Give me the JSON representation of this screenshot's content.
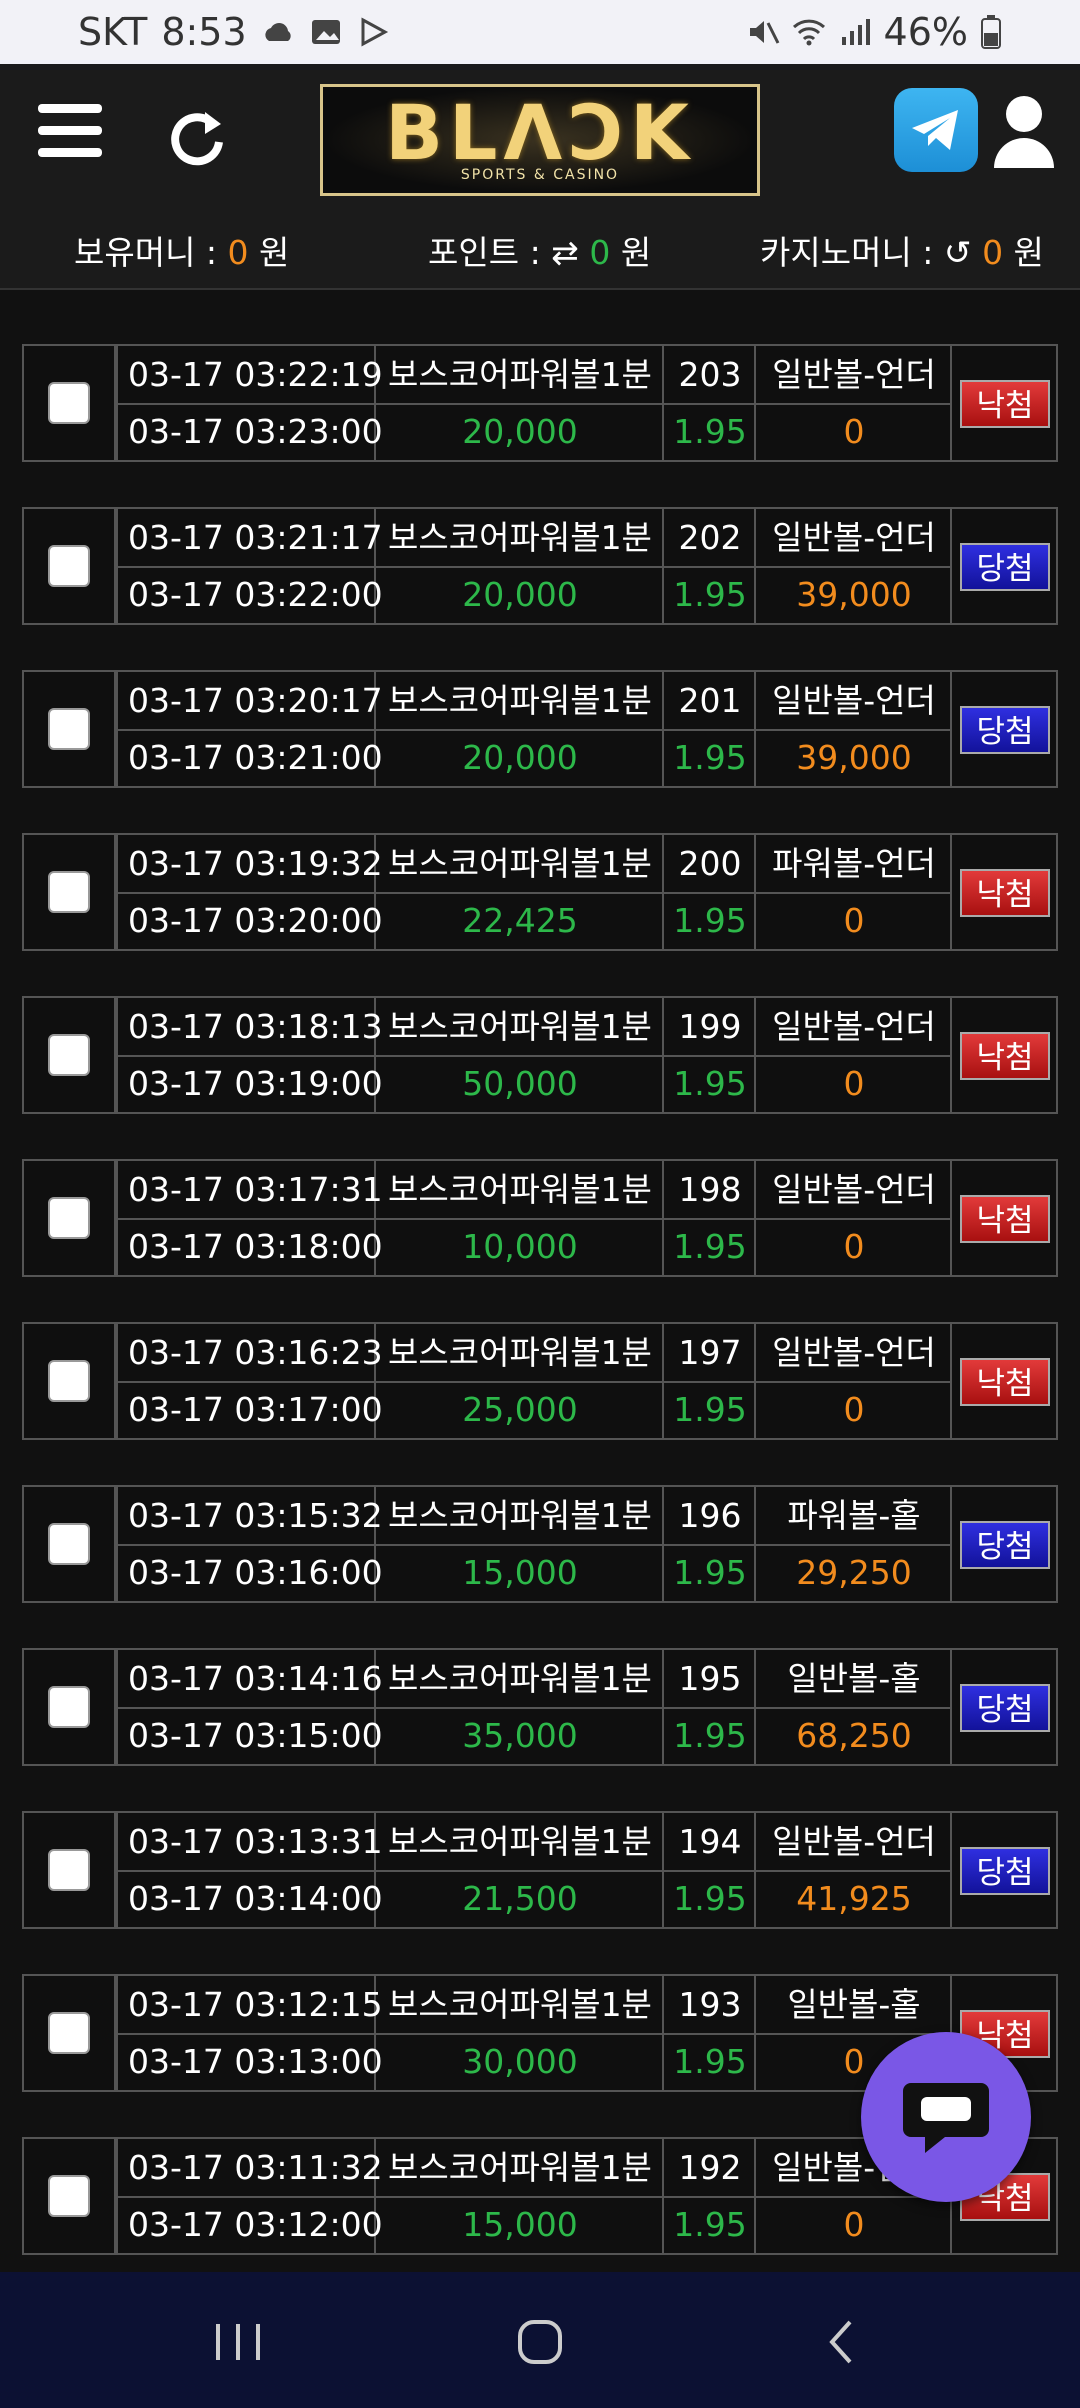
{
  "statusbar": {
    "carrier": "SKT",
    "time": "8:53",
    "battery": "46%"
  },
  "header": {
    "logo_text": "BLΛƆK",
    "logo_sub": "SPORTS & CASINO"
  },
  "balance": {
    "money_label": "보유머니 : ",
    "money_value": "0",
    "money_unit": " 원",
    "point_label": "포인트 : ",
    "point_value": "0",
    "point_unit": " 원",
    "casino_label": "카지노머니 : ",
    "casino_value": "0",
    "casino_unit": " 원"
  },
  "colors": {
    "win_badge": "#2020c0",
    "lose_badge": "#c02020",
    "amount": "#2db84a",
    "payout": "#f28c1e",
    "chat": "#7a57e6"
  },
  "bets": [
    {
      "bet_time": "03-17 03:22:19",
      "draw_time": "03-17 03:23:00",
      "game": "보스코어파워볼1분",
      "round": "203",
      "pick": "일반볼-언더",
      "amount": "20,000",
      "odds": "1.95",
      "payout": "0",
      "result": "낙첨"
    },
    {
      "bet_time": "03-17 03:21:17",
      "draw_time": "03-17 03:22:00",
      "game": "보스코어파워볼1분",
      "round": "202",
      "pick": "일반볼-언더",
      "amount": "20,000",
      "odds": "1.95",
      "payout": "39,000",
      "result": "당첨"
    },
    {
      "bet_time": "03-17 03:20:17",
      "draw_time": "03-17 03:21:00",
      "game": "보스코어파워볼1분",
      "round": "201",
      "pick": "일반볼-언더",
      "amount": "20,000",
      "odds": "1.95",
      "payout": "39,000",
      "result": "당첨"
    },
    {
      "bet_time": "03-17 03:19:32",
      "draw_time": "03-17 03:20:00",
      "game": "보스코어파워볼1분",
      "round": "200",
      "pick": "파워볼-언더",
      "amount": "22,425",
      "odds": "1.95",
      "payout": "0",
      "result": "낙첨"
    },
    {
      "bet_time": "03-17 03:18:13",
      "draw_time": "03-17 03:19:00",
      "game": "보스코어파워볼1분",
      "round": "199",
      "pick": "일반볼-언더",
      "amount": "50,000",
      "odds": "1.95",
      "payout": "0",
      "result": "낙첨"
    },
    {
      "bet_time": "03-17 03:17:31",
      "draw_time": "03-17 03:18:00",
      "game": "보스코어파워볼1분",
      "round": "198",
      "pick": "일반볼-언더",
      "amount": "10,000",
      "odds": "1.95",
      "payout": "0",
      "result": "낙첨"
    },
    {
      "bet_time": "03-17 03:16:23",
      "draw_time": "03-17 03:17:00",
      "game": "보스코어파워볼1분",
      "round": "197",
      "pick": "일반볼-언더",
      "amount": "25,000",
      "odds": "1.95",
      "payout": "0",
      "result": "낙첨"
    },
    {
      "bet_time": "03-17 03:15:32",
      "draw_time": "03-17 03:16:00",
      "game": "보스코어파워볼1분",
      "round": "196",
      "pick": "파워볼-홀",
      "amount": "15,000",
      "odds": "1.95",
      "payout": "29,250",
      "result": "당첨"
    },
    {
      "bet_time": "03-17 03:14:16",
      "draw_time": "03-17 03:15:00",
      "game": "보스코어파워볼1분",
      "round": "195",
      "pick": "일반볼-홀",
      "amount": "35,000",
      "odds": "1.95",
      "payout": "68,250",
      "result": "당첨"
    },
    {
      "bet_time": "03-17 03:13:31",
      "draw_time": "03-17 03:14:00",
      "game": "보스코어파워볼1분",
      "round": "194",
      "pick": "일반볼-언더",
      "amount": "21,500",
      "odds": "1.95",
      "payout": "41,925",
      "result": "당첨"
    },
    {
      "bet_time": "03-17 03:12:15",
      "draw_time": "03-17 03:13:00",
      "game": "보스코어파워볼1분",
      "round": "193",
      "pick": "일반볼-홀",
      "amount": "30,000",
      "odds": "1.95",
      "payout": "0",
      "result": "낙첨"
    },
    {
      "bet_time": "03-17 03:11:32",
      "draw_time": "03-17 03:12:00",
      "game": "보스코어파워볼1분",
      "round": "192",
      "pick": "일반볼-언더",
      "amount": "15,000",
      "odds": "1.95",
      "payout": "0",
      "result": "낙첨"
    }
  ]
}
